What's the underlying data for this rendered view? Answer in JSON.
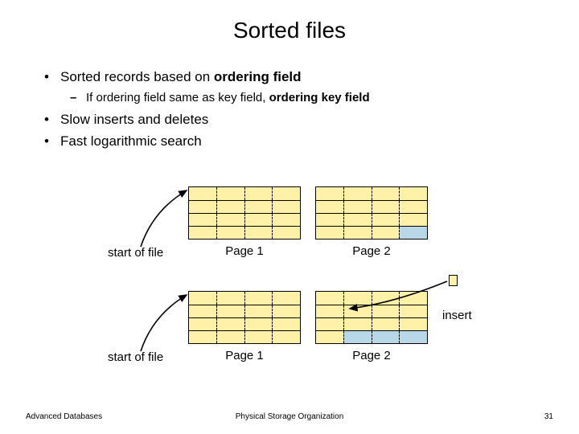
{
  "title": "Sorted files",
  "bullets": {
    "b1a": "Sorted records based on ",
    "b1a_bold": "ordering field",
    "b2a": "If ordering field same as key field, ",
    "b2a_bold": "ordering key field",
    "b3": "Slow inserts and deletes",
    "b4": "Fast logarithmic search"
  },
  "labels": {
    "start1": "start of file",
    "start2": "start of file",
    "page1a": "Page 1",
    "page2a": "Page 2",
    "page1b": "Page 1",
    "page2b": "Page 2",
    "insert": "insert"
  },
  "footer": {
    "left": "Advanced Databases",
    "center": "Physical Storage Organization",
    "right": "31"
  }
}
